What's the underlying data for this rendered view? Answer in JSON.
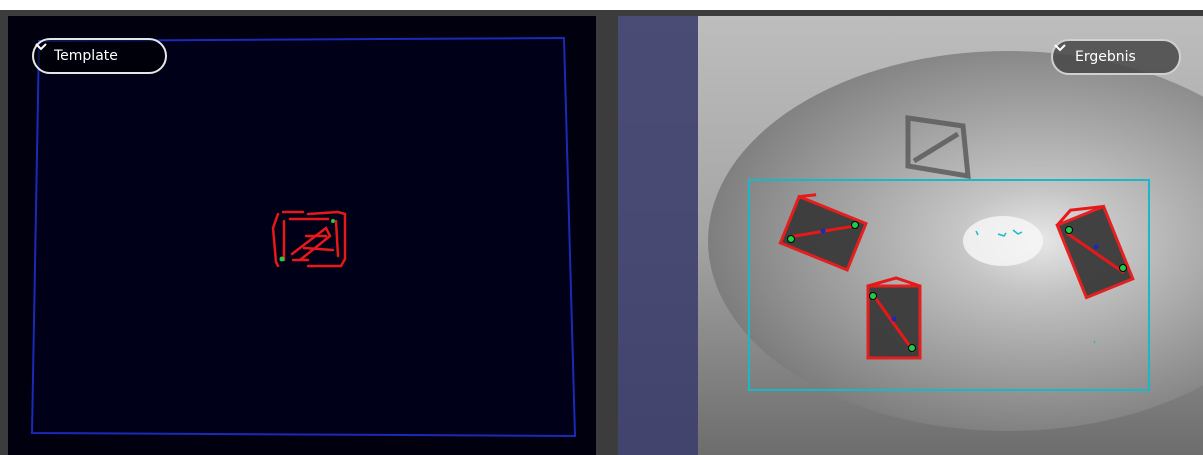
{
  "left_panel": {
    "dropdown_label": "Template",
    "dropdown_icon": "chevron-down-icon"
  },
  "right_panel": {
    "dropdown_label": "Ergebnis",
    "dropdown_icon": "chevron-down-icon"
  },
  "colors": {
    "template_frame": "#1a2ab8",
    "template_background": "#000010",
    "contour": "#e81818",
    "roi_box": "#19b8c8",
    "match_point": "#1ecc4a",
    "sidebar_overlay": "#3e3f6e"
  }
}
